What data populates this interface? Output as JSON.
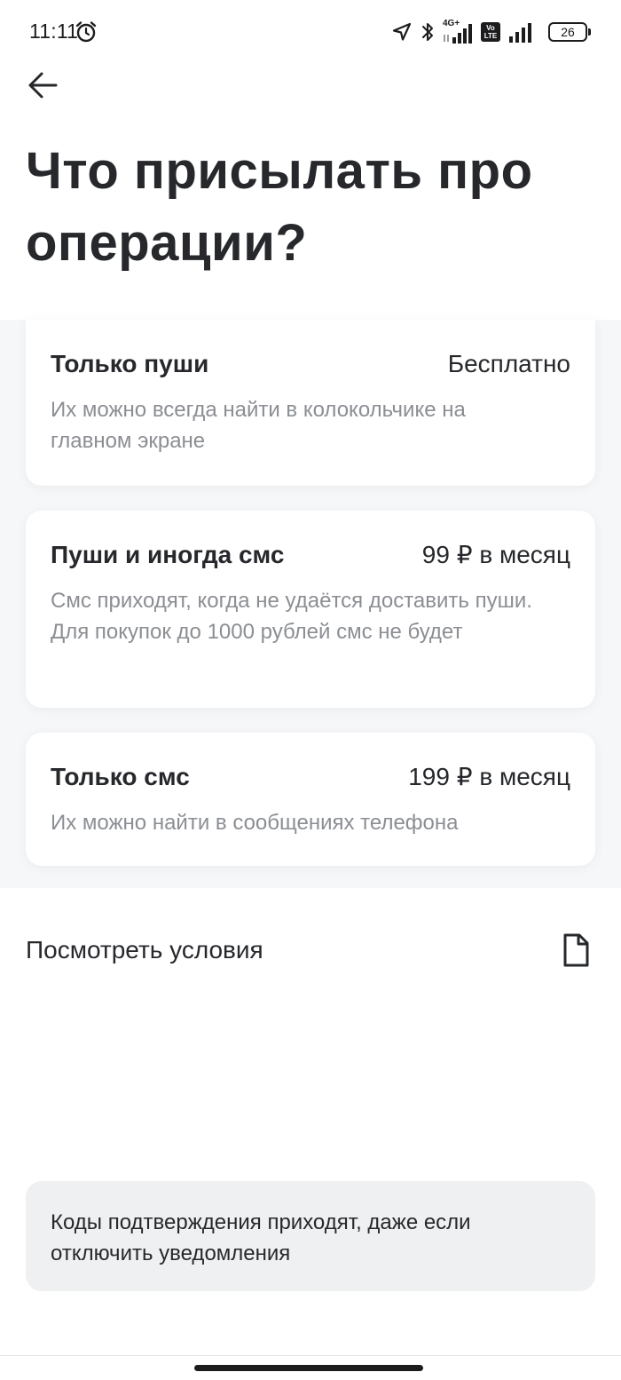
{
  "status_bar": {
    "time": "11:11",
    "network": "4G+",
    "volte_top": "Vo",
    "volte_bottom": "LTE",
    "battery": "26",
    "icons": [
      "alarm-icon",
      "location-icon",
      "bluetooth-icon",
      "signal-icon",
      "volte-icon",
      "signal-icon",
      "battery-icon"
    ]
  },
  "header": {
    "back_icon": "arrow-left-icon",
    "title": "Что присылать про операции?"
  },
  "options": [
    {
      "title": "Только пуши",
      "price": "Бесплатно",
      "description": "Их можно всегда найти в колокольчике на главном экране"
    },
    {
      "title": "Пуши и иногда смс",
      "price": "99 ₽ в месяц",
      "description": "Смс приходят, когда не удаётся доставить пуши. Для покупок до 1000 рублей смс не будет"
    },
    {
      "title": "Только смс",
      "price": "199 ₽ в месяц",
      "description": "Их можно найти в сообщениях телефона"
    }
  ],
  "conditions": {
    "label": "Посмотреть условия",
    "icon": "document-icon"
  },
  "info_note": {
    "text": "Коды подтверждения приходят, даже если отключить уведомления"
  },
  "colors": {
    "text_primary": "#26282c",
    "text_secondary": "#8b8e93",
    "card_background": "#ffffff",
    "options_background": "#f6f7f8",
    "note_background": "#eff0f1"
  }
}
